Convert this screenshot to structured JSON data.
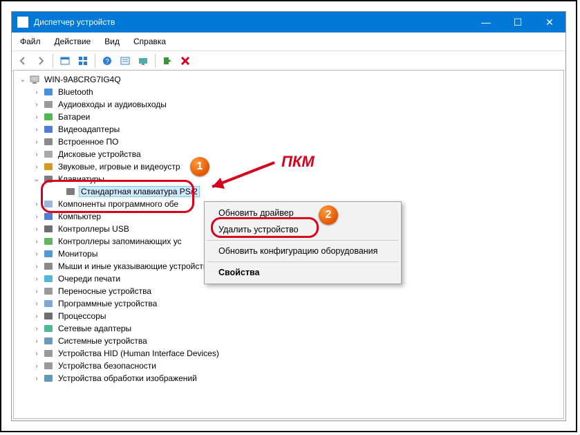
{
  "window": {
    "title": "Диспетчер устройств"
  },
  "menu": {
    "file": "Файл",
    "action": "Действие",
    "view": "Вид",
    "help": "Справка"
  },
  "root": "WIN-9A8CRG7IG4Q",
  "categories": [
    "Bluetooth",
    "Аудиовходы и аудиовыходы",
    "Батареи",
    "Видеоадаптеры",
    "Встроенное ПО",
    "Дисковые устройства",
    "Звуковые, игровые и видеоустр",
    "Клавиатуры",
    "Стандартная клавиатура PS/2",
    "Компоненты программного обе",
    "Компьютер",
    "Контроллеры USB",
    "Контроллеры запоминающих ус",
    "Мониторы",
    "Мыши и иные указывающие устройства",
    "Очереди печати",
    "Переносные устройства",
    "Программные устройства",
    "Процессоры",
    "Сетевые адаптеры",
    "Системные устройства",
    "Устройства HID (Human Interface Devices)",
    "Устройства безопасности",
    "Устройства обработки изображений"
  ],
  "context": {
    "update": "Обновить драйвер",
    "uninstall": "Удалить устройство",
    "scan": "Обновить конфигурацию оборудования",
    "props": "Свойства"
  },
  "annot": {
    "rmb": "ПКМ",
    "b1": "1",
    "b2": "2"
  }
}
